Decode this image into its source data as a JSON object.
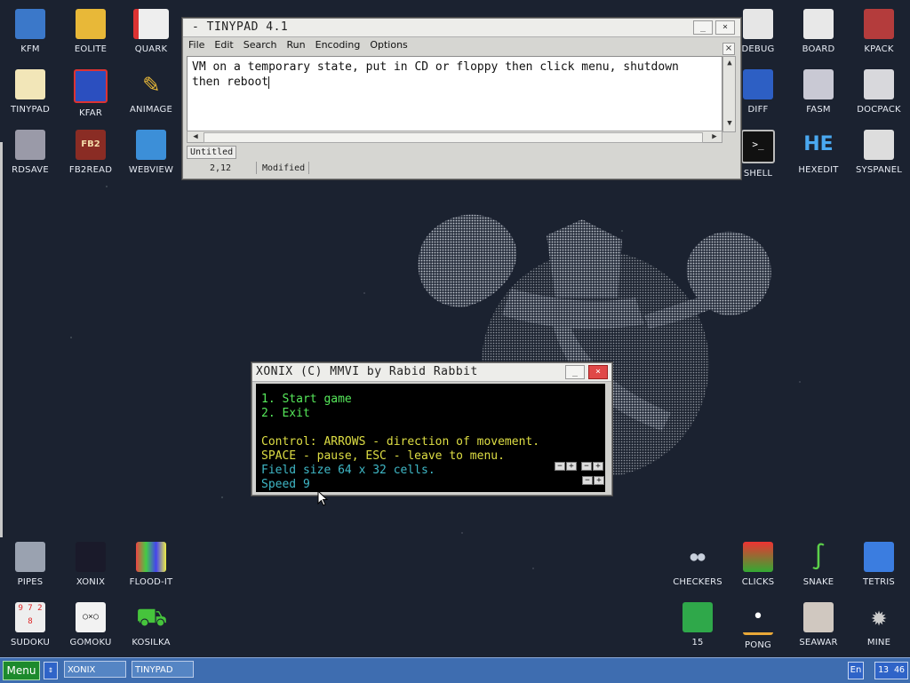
{
  "desktop": {
    "icons_left": [
      {
        "label": "KFM",
        "name": "kfm"
      },
      {
        "label": "EOLITE",
        "name": "eolite"
      },
      {
        "label": "QUARK",
        "name": "quark"
      },
      {
        "label": "TINYPAD",
        "name": "tinypad"
      },
      {
        "label": "KFAR",
        "name": "kfar"
      },
      {
        "label": "ANIMAGE",
        "name": "animage"
      },
      {
        "label": "RDSAVE",
        "name": "rdsave"
      },
      {
        "label": "FB2READ",
        "name": "fb2read"
      },
      {
        "label": "WEBVIEW",
        "name": "webview"
      }
    ],
    "icons_right": [
      {
        "label": "DEBUG",
        "name": "debug"
      },
      {
        "label": "BOARD",
        "name": "board"
      },
      {
        "label": "KPACK",
        "name": "kpack"
      },
      {
        "label": "DIFF",
        "name": "diff"
      },
      {
        "label": "FASM",
        "name": "fasm"
      },
      {
        "label": "DOCPACK",
        "name": "docpack"
      },
      {
        "label": "SHELL",
        "name": "shell"
      },
      {
        "label": "HEXEDIT",
        "name": "hexedit"
      },
      {
        "label": "SYSPANEL",
        "name": "syspanel"
      }
    ],
    "icons_bottom_left": [
      {
        "label": "PIPES",
        "name": "pipes"
      },
      {
        "label": "XONIX",
        "name": "xonix"
      },
      {
        "label": "FLOOD-IT",
        "name": "flood-it"
      },
      {
        "label": "SUDOKU",
        "name": "sudoku"
      },
      {
        "label": "GOMOKU",
        "name": "gomoku"
      },
      {
        "label": "KOSILKA",
        "name": "kosilka"
      }
    ],
    "icons_bottom_right": [
      {
        "label": "CHECKERS",
        "name": "checkers"
      },
      {
        "label": "CLICKS",
        "name": "clicks"
      },
      {
        "label": "SNAKE",
        "name": "snake"
      },
      {
        "label": "TETRIS",
        "name": "tetris"
      },
      {
        "label": "15",
        "name": "fifteen"
      },
      {
        "label": "PONG",
        "name": "pong"
      },
      {
        "label": "SEAWAR",
        "name": "seawar"
      },
      {
        "label": "MINE",
        "name": "mine"
      }
    ],
    "sudoku_digits": "9 7 2 8"
  },
  "tinypad": {
    "title": "- TINYPAD 4.1",
    "menu": [
      "File",
      "Edit",
      "Search",
      "Run",
      "Encoding",
      "Options"
    ],
    "text_line1": "VM on a temporary state, put in CD or floppy then click menu, shutdown",
    "text_line2": "then reboot",
    "tab_label": "Untitled",
    "cursor_pos": "2,12",
    "status": "Modified",
    "minimize": "_",
    "close": "×"
  },
  "xonix": {
    "title": "XONIX (C) MMVI by Rabid Rabbit",
    "item1": "1. Start game",
    "item2": "2. Exit",
    "control1": "Control: ARROWS - direction of movement.",
    "control2": "SPACE - pause, ESC - leave to menu.",
    "field_size": "Field size 64 x 32 cells.",
    "speed": "Speed 9",
    "minimize": "_",
    "close": "×",
    "minus": "−",
    "plus": "+"
  },
  "taskbar": {
    "menu_label": "Menu",
    "tasks": [
      "XONIX",
      "TINYPAD"
    ],
    "lang": "En",
    "clock": "13 46"
  },
  "colors": {
    "desktop_bg": "#1b2230",
    "taskbar": "#3e6db0",
    "menu_button": "#1c8a2c",
    "xonix_green": "#56e85a",
    "xonix_yellow": "#dede44",
    "xonix_cyan": "#3fb8c7"
  }
}
